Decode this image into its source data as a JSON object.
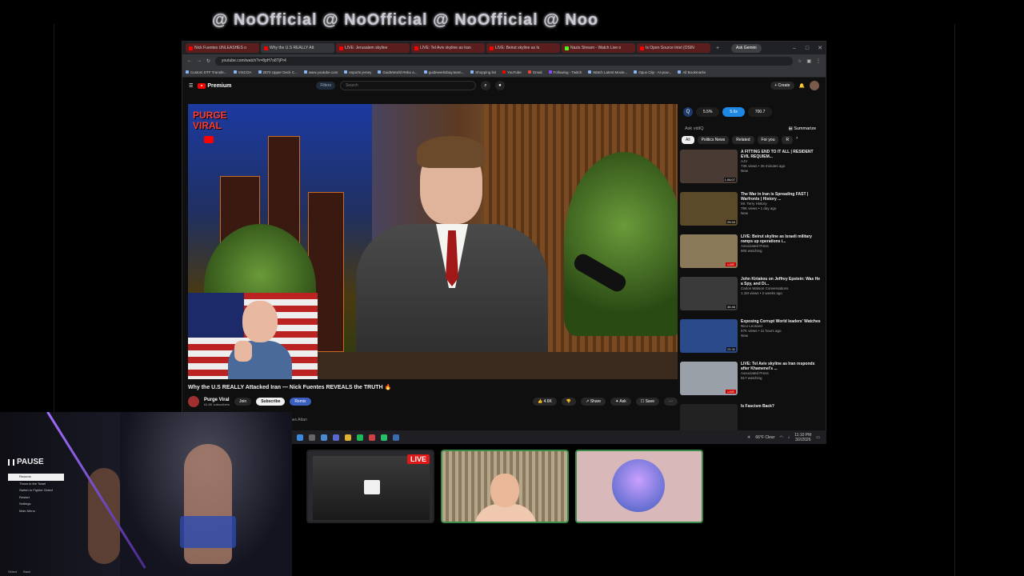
{
  "overlay": {
    "banner_text": "@ NoOfficial @ NoOfficial @ NoOfficial @ Noo"
  },
  "browser": {
    "tabs": [
      {
        "label": "Nick Fuentes UNLEASHES o"
      },
      {
        "label": "Why the U.S REALLY Att"
      },
      {
        "label": "LIVE: Jerusalem skyline"
      },
      {
        "label": "LIVE: Tel Aviv skyline as Iran"
      },
      {
        "label": "LIVE: Beirut skyline as Is"
      },
      {
        "label": "Nazis Stream - Watch Live o"
      },
      {
        "label": "Is Open Source Intel (OSIN"
      }
    ],
    "ask_gemini": "Ask Gemini",
    "url": "youtube.com/watch?v=8pH7o8TjPr4",
    "bookmarks": [
      "Custom DTF Transfe...",
      "VISCOA",
      "2870 Upper Deck C...",
      "www.youtube.com",
      "esports jersey",
      "GuideWorld Rebo a...",
      "guidewerksbay.team...",
      "Shopping list",
      "YouTube",
      "Gmail",
      "Following - Twitch",
      "Watch Latest Movie...",
      "Opus Clip - AI-pow...",
      "All Bookmarks"
    ]
  },
  "youtube": {
    "logo": "Premium",
    "filters_label": "Filters",
    "search_placeholder": "Search",
    "create_label": "Create",
    "video": {
      "overlay_brand_line1": "PURGE",
      "overlay_brand_line2": "VIRAL",
      "title": "Why the U.S REALLY Attacked Iran — Nick Fuentes REVEALS the TRUTH 🔥",
      "channel_name": "Purge Viral",
      "subscribers": "61.8K subscribers",
      "join_label": "Join",
      "subscribe_label": "Subscribe",
      "remix_label": "Remix",
      "likes": "4.6K",
      "share_label": "Share",
      "ask_label": "Ask",
      "save_label": "Save",
      "below_caption": "nes Attan"
    },
    "sidebar": {
      "stats": [
        "5.5%",
        "5.6x",
        "700.7"
      ],
      "ask_placeholder": "Ask vidIQ",
      "summarize_label": "Summarize",
      "chips": [
        "All",
        "Politics News",
        "Related",
        "For you",
        "R"
      ],
      "recs": [
        {
          "title": "A FITTING END TO IT ALL | RESIDENT EVIL REQUIEM...",
          "channel": "AJV",
          "meta": "73K views • 46 minutes ago",
          "badge": "New",
          "duration": "1:06:07",
          "thumb_color": "#4a3a34"
        },
        {
          "title": "The War in Iran is Spreading FAST | Warfronts | History ...",
          "channel": "Mr. Terry History",
          "meta": "78K views • 1 day ago",
          "badge": "New",
          "duration": "25:34",
          "thumb_color": "#5a4a2a"
        },
        {
          "title": "LIVE: Beirut skyline as Israeli military ramps up operations i...",
          "channel": "Associated Press",
          "meta": "905 watching",
          "badge": "",
          "duration": "LIVE",
          "thumb_color": "#8a7a5a"
        },
        {
          "title": "John Kiriakou on Jeffrey Epstein: Was He a Spy, and Di...",
          "channel": "Carlos Watson Conversations",
          "meta": "1.1M views • 2 weeks ago",
          "badge": "",
          "duration": "36:46",
          "thumb_color": "#3a3a3a"
        },
        {
          "title": "Exposing Corrupt World leaders' Watches",
          "channel": "Nico Leonard",
          "meta": "57K views • 11 hours ago",
          "badge": "New",
          "duration": "21:11",
          "thumb_color": "#2a4a8a"
        },
        {
          "title": "LIVE: Tel Aviv skyline as Iran responds after Khamenei's ...",
          "channel": "Associated Press",
          "meta": "817 watching",
          "badge": "",
          "duration": "LIVE",
          "thumb_color": "#9aa0a8"
        },
        {
          "title": "Is Fascism Back?",
          "channel": "",
          "meta": "",
          "badge": "",
          "duration": "",
          "thumb_color": "#222"
        }
      ]
    }
  },
  "taskbar": {
    "weather": "66°F Clear",
    "time": "11:10 PM",
    "date": "3/2/2026"
  },
  "webcams": {
    "live_badge": "LIVE"
  },
  "game_pause": {
    "header": "PAUSE",
    "items": [
      "Resume",
      "Throw in the Towel",
      "Switch to Fighter Select",
      "Restart",
      "Settings",
      "Main Menu"
    ],
    "footer": [
      "Select",
      "Back"
    ]
  }
}
